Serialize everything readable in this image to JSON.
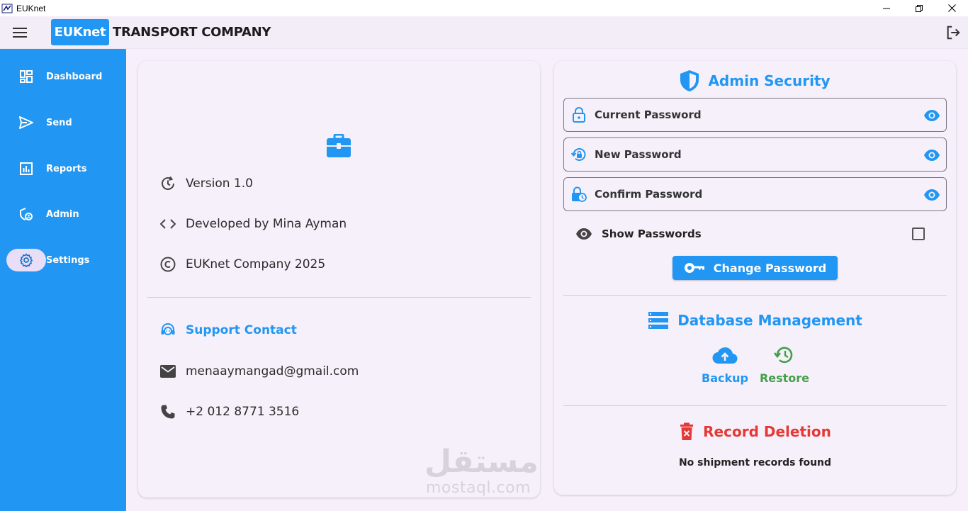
{
  "window": {
    "title": "EUKnet",
    "controls": [
      "minimize-icon",
      "restore-icon",
      "close-icon"
    ]
  },
  "header": {
    "brand_box": "EUKnet",
    "brand_name": "TRANSPORT COMPANY",
    "menu_icon": "hamburger-icon",
    "logout_icon": "logout-icon"
  },
  "sidebar": {
    "items": [
      {
        "label": "Dashboard",
        "icon": "dashboard-icon"
      },
      {
        "label": "Send",
        "icon": "send-icon"
      },
      {
        "label": "Reports",
        "icon": "reports-icon"
      },
      {
        "label": "Admin",
        "icon": "admin-icon"
      },
      {
        "label": "Settings",
        "icon": "gear-icon",
        "active": true
      }
    ]
  },
  "about": {
    "icon": "briefcase-icon",
    "version": "Version 1.0",
    "developer": "Developed by Mina Ayman",
    "copyright": "EUKnet Company 2025"
  },
  "support": {
    "title": "Support Contact",
    "email": "menaaymangad@gmail.com",
    "phone": "+2 012 8771 3516"
  },
  "watermark": {
    "arabic": "مستقل",
    "latin": "mostaql.com"
  },
  "security": {
    "title": "Admin Security",
    "current_password": "Current Password",
    "new_password": "New Password",
    "confirm_password": "Confirm Password",
    "show_passwords": "Show Passwords",
    "show_passwords_checked": false,
    "change_button": "Change Password"
  },
  "database": {
    "title": "Database Management",
    "backup": "Backup",
    "restore": "Restore"
  },
  "deletion": {
    "title": "Record Deletion",
    "empty_message": "No shipment records found"
  },
  "colors": {
    "primary": "#2196f3",
    "restore_green": "#43a047",
    "danger_red": "#e53935",
    "background": "#f7f0fb",
    "active_pill": "#e8def8"
  }
}
